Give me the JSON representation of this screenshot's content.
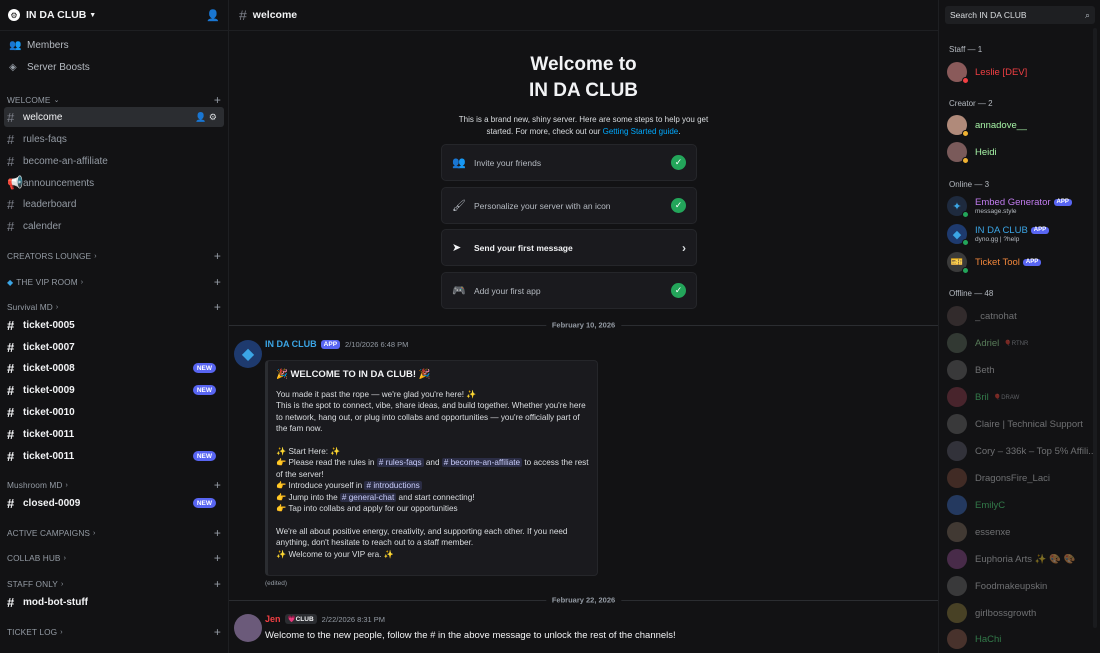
{
  "server": {
    "name": "IN DA CLUB"
  },
  "nav": [
    {
      "label": "Members",
      "icon": "members-icon"
    },
    {
      "label": "Server Boosts",
      "icon": "boost-icon"
    }
  ],
  "categories": [
    {
      "name": "WELCOME",
      "channels": [
        {
          "name": "welcome",
          "active": true
        },
        {
          "name": "rules-faqs"
        },
        {
          "name": "become-an-affiliate"
        },
        {
          "name": "announcements"
        },
        {
          "name": "leaderboard"
        },
        {
          "name": "calender"
        }
      ]
    },
    {
      "name": "CREATORS LOUNGE"
    },
    {
      "name": "THE VIP ROOM"
    },
    {
      "name": "Survival MD",
      "channels": [
        {
          "name": "ticket-0005"
        },
        {
          "name": "ticket-0007"
        },
        {
          "name": "ticket-0008",
          "badge": "NEW"
        },
        {
          "name": "ticket-0009",
          "badge": "NEW"
        },
        {
          "name": "ticket-0010"
        },
        {
          "name": "ticket-0011"
        },
        {
          "name": "ticket-0011",
          "badge": "NEW"
        }
      ]
    },
    {
      "name": "Mushroom MD",
      "channels": [
        {
          "name": "closed-0009",
          "badge": "NEW"
        }
      ]
    },
    {
      "name": "ACTIVE CAMPAIGNS"
    },
    {
      "name": "COLLAB HUB"
    },
    {
      "name": "STAFF ONLY",
      "channels": [
        {
          "name": "mod-bot-stuff"
        }
      ]
    },
    {
      "name": "TICKET LOG"
    }
  ],
  "channel": {
    "title": "welcome"
  },
  "welcome": {
    "line1": "Welcome to",
    "line2": "IN DA CLUB",
    "intro": "This is a brand new, shiny server. Here are some steps to help you get started. For more, check out our",
    "intro_link": "Getting Started guide",
    "steps": [
      {
        "label": "Invite your friends",
        "done": true
      },
      {
        "label": "Personalize your server with an icon",
        "done": true
      },
      {
        "label": "Send your first message",
        "done": false
      },
      {
        "label": "Add your first app",
        "done": true
      }
    ]
  },
  "dates": [
    "February 10, 2026",
    "February 22, 2026"
  ],
  "messages": [
    {
      "author": "IN DA CLUB",
      "tag": "APP",
      "time": "2/10/2026 6:48 PM",
      "embed": {
        "title": "🎉 WELCOME TO IN DA CLUB! 🎉",
        "p1": "You made it past the rope — we're glad you're here! ✨",
        "p2": "This is the spot to connect, vibe, share ideas, and build together. Whether you're here to network, hang out, or plug into collabs and opportunities — you're officially part of the fam now.",
        "start": "✨ Start Here: ✨",
        "s1a": "👉 Please read the rules in",
        "s1m1": "# rules-faqs",
        "s1b": "and",
        "s1m2": "# become-an-affiliate",
        "s1c": "to access the rest of the server!",
        "s2a": "👉 Introduce yourself in",
        "s2m": "# introductions",
        "s3a": "👉 Jump into the",
        "s3m": "# general-chat",
        "s3b": "and start connecting!",
        "s4": "👉 Tap into collabs and apply for our opportunities",
        "p3": "We're all about positive energy, creativity, and supporting each other. If you need anything, don't hesitate to reach out to a staff member.",
        "p4": "✨ Welcome to your VIP era. ✨"
      },
      "edited": "(edited)"
    },
    {
      "author": "Jen",
      "tag": "💗CLUB",
      "time": "2/22/2026 8:31 PM",
      "text": "Welcome to the new people, follow the # in the above message to unlock the rest of the channels!"
    }
  ],
  "search": {
    "placeholder": "Search IN DA CLUB"
  },
  "members": {
    "staff": {
      "header": "Staff — 1",
      "list": [
        {
          "name": "Leslie [DEV]",
          "color": "#f23f43"
        }
      ]
    },
    "creator": {
      "header": "Creator — 2",
      "list": [
        {
          "name": "annadove__",
          "color": "#a6f3a6"
        },
        {
          "name": "Heidi",
          "color": "#a6f3a6"
        }
      ]
    },
    "online": {
      "header": "Online — 3",
      "list": [
        {
          "name": "Embed Generator",
          "tag": "APP",
          "sub": "message.style",
          "color": "#c27cf0"
        },
        {
          "name": "IN DA CLUB",
          "tag": "APP",
          "sub": "dyno.gg | ?help",
          "color": "#3ba5e5"
        },
        {
          "name": "Ticket Tool",
          "tag": "APP",
          "sub": "",
          "color": "#f0863b"
        }
      ]
    },
    "offline": {
      "header": "Offline — 48",
      "list": [
        {
          "name": "_catnohat",
          "color": "#dbdee1"
        },
        {
          "name": "Adriel",
          "badge": "🎈RTNR",
          "color": "#a6f3a6"
        },
        {
          "name": "Beth",
          "color": "#dbdee1"
        },
        {
          "name": "Bril",
          "badge": "🎈DRAW",
          "color": "#57f287"
        },
        {
          "name": "Claire | Technical Support",
          "color": "#dbdee1"
        },
        {
          "name": "Cory – 336k – Top 5% Affili...",
          "color": "#dbdee1"
        },
        {
          "name": "DragonsFire_Laci",
          "color": "#dbdee1"
        },
        {
          "name": "EmilyC",
          "color": "#57f287"
        },
        {
          "name": "essenxe",
          "color": "#dbdee1"
        },
        {
          "name": "Euphoria Arts ✨ 🎨 🎨",
          "color": "#dbdee1"
        },
        {
          "name": "Foodmakeupskin",
          "color": "#dbdee1"
        },
        {
          "name": "girlbossgrowth",
          "color": "#dbdee1"
        },
        {
          "name": "HaChi",
          "color": "#57f287"
        }
      ]
    }
  }
}
